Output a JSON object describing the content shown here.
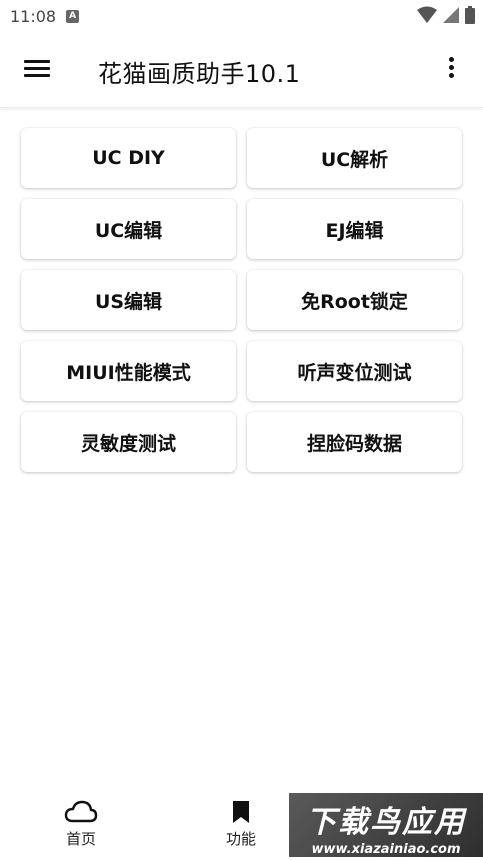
{
  "status_bar": {
    "time": "11:08",
    "notification_icon": "A"
  },
  "app_bar": {
    "title": "花猫画质助手10.1"
  },
  "features": [
    {
      "label": "UC DIY"
    },
    {
      "label": "UC解析"
    },
    {
      "label": "UC编辑"
    },
    {
      "label": "EJ编辑"
    },
    {
      "label": "US编辑"
    },
    {
      "label": "免Root锁定"
    },
    {
      "label": "MIUI性能模式"
    },
    {
      "label": "听声变位测试"
    },
    {
      "label": "灵敏度测试"
    },
    {
      "label": "捏脸码数据"
    }
  ],
  "bottom_nav": {
    "home": {
      "label": "首页",
      "icon": "cloud-icon"
    },
    "functions": {
      "label": "功能",
      "icon": "bookmark-icon"
    },
    "third": {
      "label": "",
      "icon": "hidden-under-watermark"
    }
  },
  "watermark": {
    "title": "下载鸟应用",
    "url": "www.xiazainiao.com"
  }
}
